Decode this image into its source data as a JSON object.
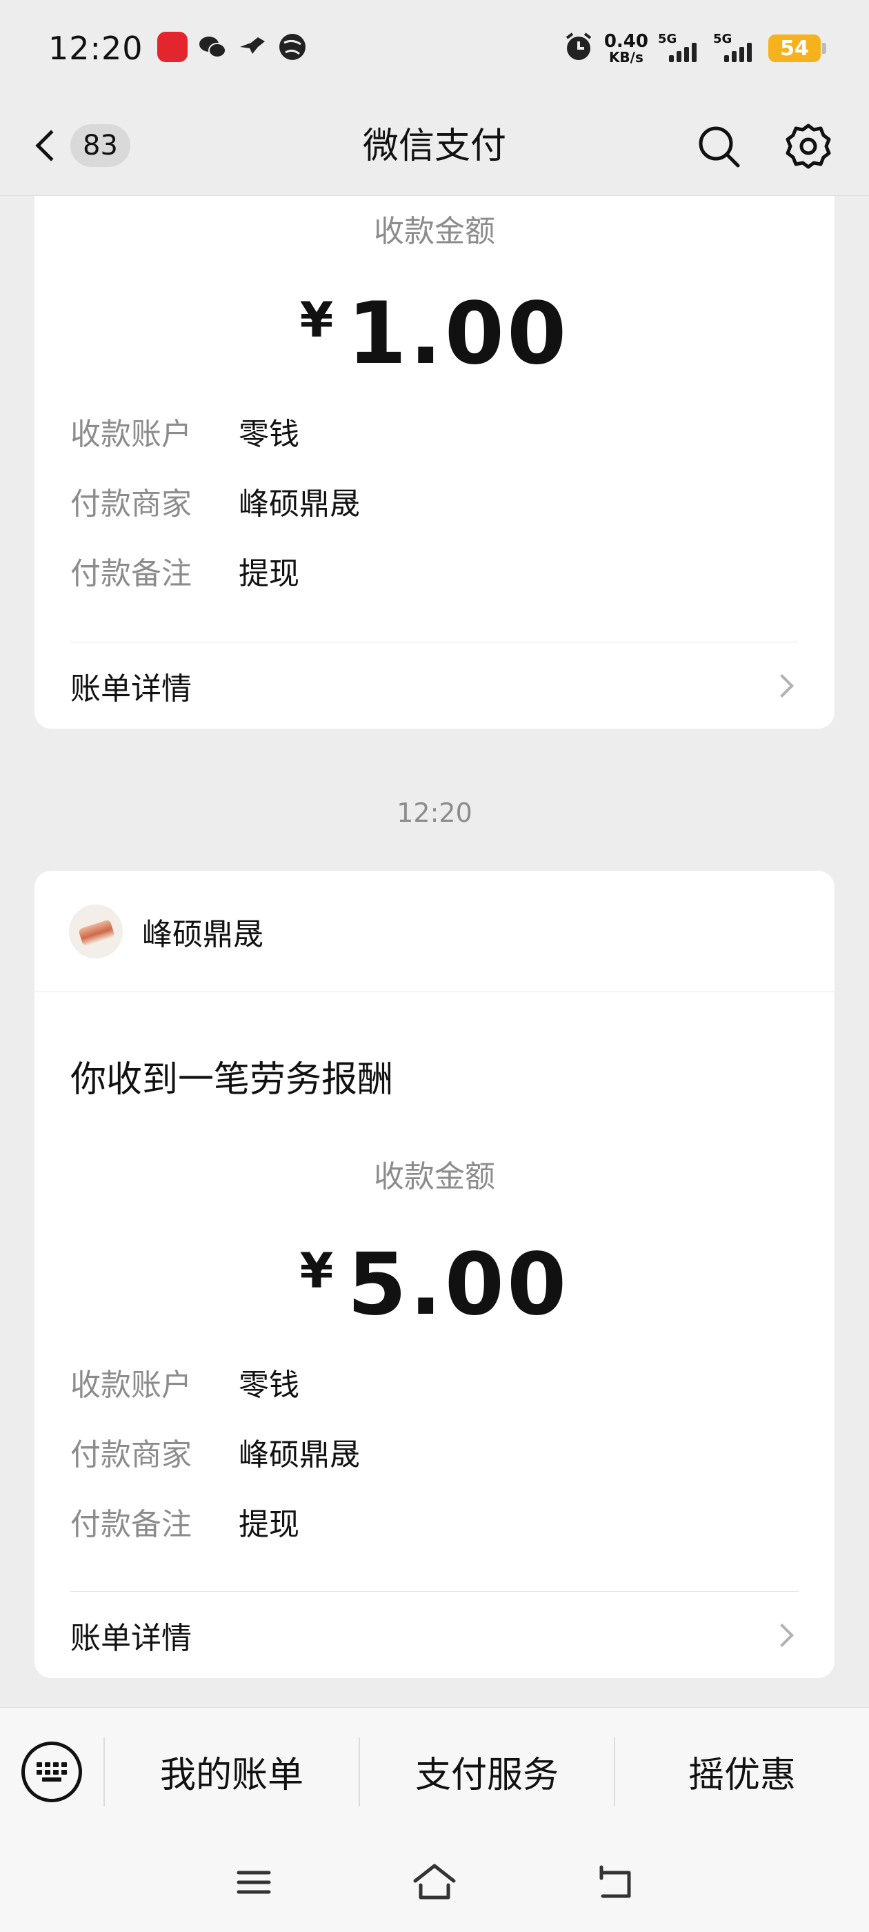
{
  "status_bar": {
    "time": "12:20",
    "net_speed_value": "0.40",
    "net_speed_unit": "KB/s",
    "sim1_label": "5G",
    "sim2_label": "5G",
    "battery_level": "54",
    "battery_color": "#f5b21c"
  },
  "nav": {
    "unread_count": "83",
    "title": "微信支付",
    "search_icon": "search-icon",
    "settings_icon": "gear-icon"
  },
  "messages": [
    {
      "amount_label": "收款金额",
      "currency": "¥",
      "amount": "1.00",
      "details": [
        {
          "key": "收款账户",
          "value": "零钱"
        },
        {
          "key": "付款商家",
          "value": "峰硕鼎晟"
        },
        {
          "key": "付款备注",
          "value": "提现"
        }
      ],
      "bill_link": "账单详情"
    },
    {
      "timestamp": "12:20",
      "merchant": "峰硕鼎晟",
      "title": "你收到一笔劳务报酬",
      "amount_label": "收款金额",
      "currency": "¥",
      "amount": "5.00",
      "details": [
        {
          "key": "收款账户",
          "value": "零钱"
        },
        {
          "key": "付款商家",
          "value": "峰硕鼎晟"
        },
        {
          "key": "付款备注",
          "value": "提现"
        }
      ],
      "bill_link": "账单详情"
    }
  ],
  "bottom_menu": {
    "keyboard_icon": "keyboard-icon",
    "items": [
      "我的账单",
      "支付服务",
      "摇优惠"
    ]
  },
  "system_nav": {
    "menu_icon": "menu-icon",
    "home_icon": "home-icon",
    "back_icon": "back-icon"
  }
}
